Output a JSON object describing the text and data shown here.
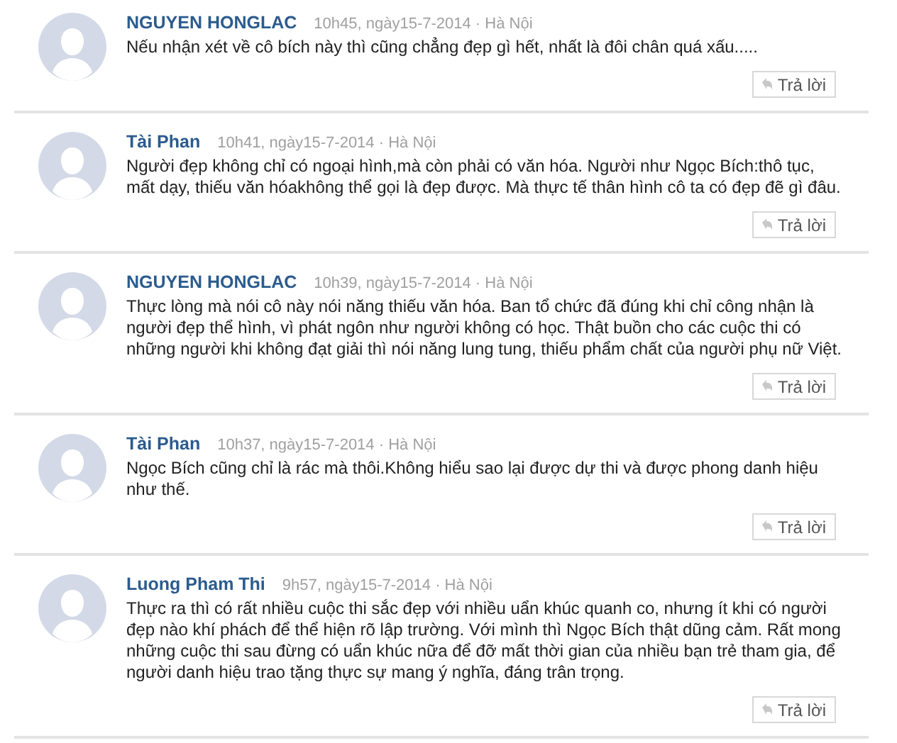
{
  "comments": [
    {
      "author": "NGUYEN HONGLAC",
      "meta": "10h45, ngày15-7-2014 · Hà Nội",
      "text": "Nếu nhận xét về cô bích này thì cũng chẳng đẹp gì hết, nhất là đôi chân quá xấu.....",
      "reply": "Trả lời"
    },
    {
      "author": "Tài Phan",
      "meta": "10h41, ngày15-7-2014 · Hà Nội",
      "text": "Người đẹp không chỉ có ngoại hình,mà còn phải có văn hóa. Người như Ngọc Bích:thô tục, mất dạy, thiếu văn hóakhông thể gọi là đẹp được. Mà thực tế thân hình cô ta có đẹp đẽ gì đâu.",
      "reply": "Trả lời"
    },
    {
      "author": "NGUYEN HONGLAC",
      "meta": "10h39, ngày15-7-2014 · Hà Nội",
      "text": "Thực lòng mà nói cô này nói năng thiếu văn hóa. Ban tổ chức đã đúng khi chỉ công nhận là người đẹp thể hình, vì phát ngôn như người không có học. Thật buồn cho các cuộc thi có những người khi không đạt giải thì nói năng lung tung, thiếu phẩm chất của người phụ nữ Việt.",
      "reply": "Trả lời"
    },
    {
      "author": "Tài Phan",
      "meta": "10h37, ngày15-7-2014 · Hà Nội",
      "text": "Ngọc Bích cũng chỉ là rác mà thôi.Không hiểu sao lại được dự thi và được phong danh hiệu như thế.",
      "reply": "Trả lời"
    },
    {
      "author": "Luong Pham Thi",
      "meta": "9h57, ngày15-7-2014 · Hà Nội",
      "text": "Thực ra thì có rất nhiều cuộc thi sắc đẹp với nhiều uẩn khúc quanh co, nhưng ít khi có người đẹp nào khí phách để thể hiện rõ lập trường. Với mình thì Ngọc Bích thật dũng cảm. Rất mong những cuộc thi sau đừng có uẩn khúc nữa để đỡ mất thời gian của nhiều bạn trẻ tham gia, để người danh hiệu trao tặng thực sự mang ý nghĩa, đáng trân trọng.",
      "reply": "Trả lời"
    }
  ]
}
